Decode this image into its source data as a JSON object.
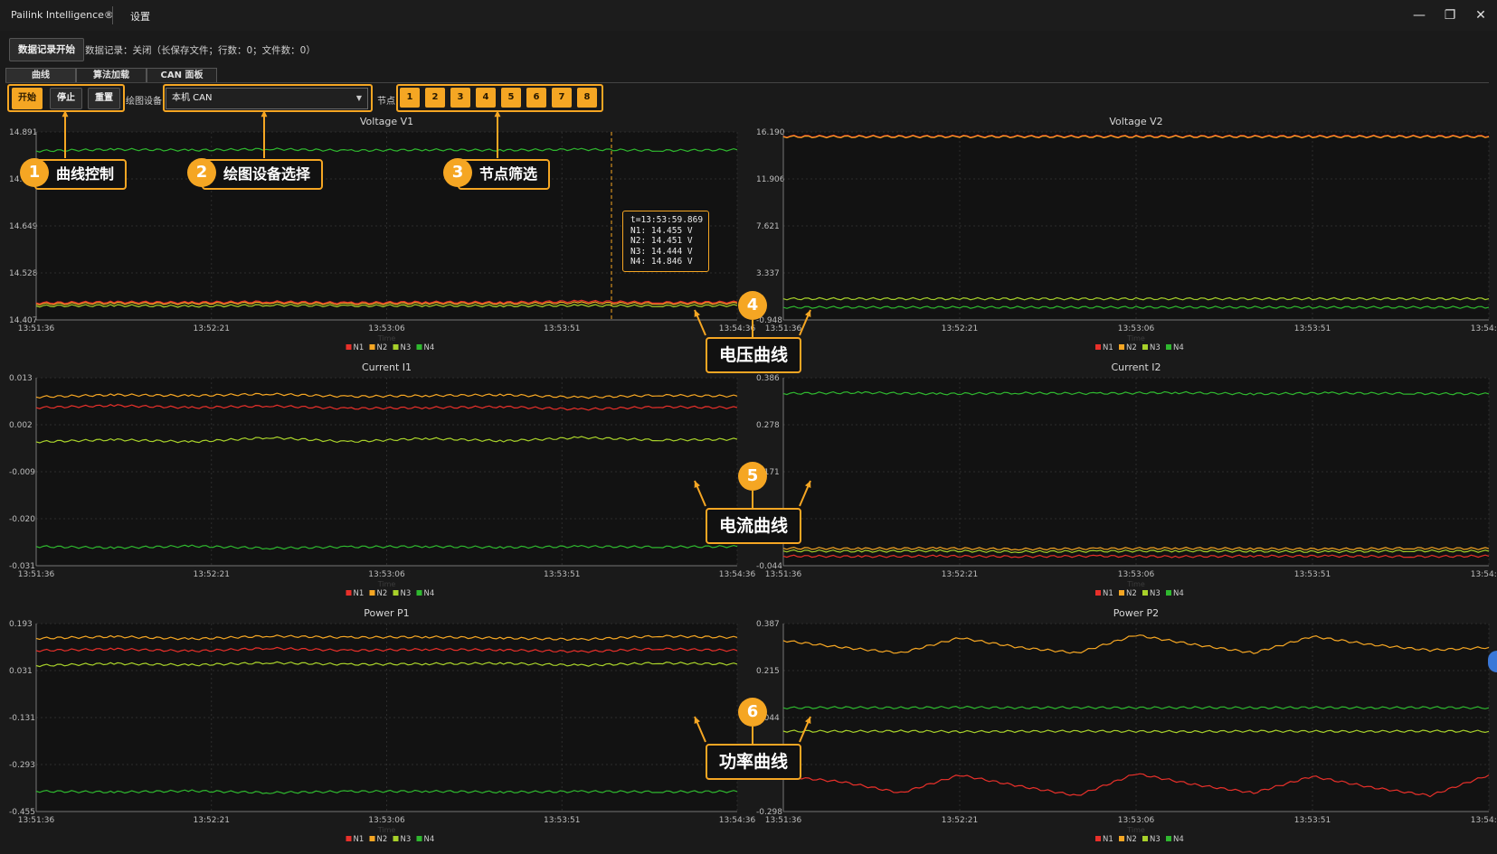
{
  "titlebar": {
    "app_title": "Pailink Intelligence®",
    "settings_label": "设置",
    "minimize_glyph": "—",
    "restore_glyph": "❐",
    "close_glyph": "✕"
  },
  "record": {
    "start_label": "数据记录开始",
    "status": "数据记录：关闭（长保存文件；行数：0；文件数：0）"
  },
  "tabs": [
    {
      "label": "曲线",
      "active": true
    },
    {
      "label": "算法加载",
      "active": false
    },
    {
      "label": "CAN 面板",
      "active": false
    }
  ],
  "controls": {
    "start": "开始",
    "stop": "停止",
    "reset": "重置",
    "device_label": "绘图设备",
    "device_value": "本机 CAN",
    "node_label": "节点",
    "nodes": [
      "1",
      "2",
      "3",
      "4",
      "5",
      "6",
      "7",
      "8"
    ]
  },
  "annotations": {
    "n1": "1",
    "l1": "曲线控制",
    "n2": "2",
    "l2": "绘图设备选择",
    "n3": "3",
    "l3": "节点筛选",
    "n4": "4",
    "l4": "电压曲线",
    "n5": "5",
    "l5": "电流曲线",
    "n6": "6",
    "l6": "功率曲线"
  },
  "tooltip": {
    "t": "t=13:53:59.869",
    "n1": "N1: 14.455 V",
    "n2": "N2: 14.451 V",
    "n3": "N3: 14.444 V",
    "n4": "N4: 14.846 V"
  },
  "colors": {
    "accent": "#f5a623",
    "N1": "#e8302a",
    "N2": "#f5a623",
    "N3": "#a8d12a",
    "N4": "#2fb82f",
    "plot_bg": "#121212",
    "grid": "#2c2c2c"
  },
  "chart_data": [
    {
      "type": "line",
      "title": "Voltage V1",
      "xlabel": "Time",
      "x_ticks": [
        "13:51:36",
        "13:52:21",
        "13:53:06",
        "13:53:51",
        "13:54:36"
      ],
      "y_ticks": [
        "14.891",
        "14.770",
        "14.649",
        "14.528",
        "14.407"
      ],
      "ylim": [
        14.407,
        14.891
      ],
      "legend": [
        "N1",
        "N2",
        "N3",
        "N4"
      ],
      "series": [
        {
          "name": "N1",
          "values": [
            14.451,
            14.453,
            14.452,
            14.454,
            14.451,
            14.453,
            14.452,
            14.455,
            14.452,
            14.453
          ]
        },
        {
          "name": "N2",
          "values": [
            14.448,
            14.45,
            14.449,
            14.451,
            14.448,
            14.45,
            14.449,
            14.451,
            14.449,
            14.45
          ]
        },
        {
          "name": "N3",
          "values": [
            14.443,
            14.444,
            14.442,
            14.445,
            14.443,
            14.444,
            14.443,
            14.444,
            14.443,
            14.444
          ]
        },
        {
          "name": "N4",
          "values": [
            14.842,
            14.846,
            14.844,
            14.847,
            14.843,
            14.845,
            14.844,
            14.846,
            14.843,
            14.845
          ]
        }
      ]
    },
    {
      "type": "line",
      "title": "Voltage V2",
      "xlabel": "Time",
      "x_ticks": [
        "13:51:36",
        "13:52:21",
        "13:53:06",
        "13:53:51",
        "13:54:36"
      ],
      "y_ticks": [
        "16.190",
        "11.906",
        "7.621",
        "3.337",
        "-0.948"
      ],
      "ylim": [
        -0.948,
        16.19
      ],
      "legend": [
        "N1",
        "N2",
        "N3",
        "N4"
      ],
      "series": [
        {
          "name": "N1",
          "values": [
            15.8,
            15.8,
            15.8,
            15.8,
            15.8
          ]
        },
        {
          "name": "N2",
          "values": [
            15.75,
            15.75,
            15.75,
            15.75,
            15.75
          ]
        },
        {
          "name": "N3",
          "values": [
            0.98,
            0.98,
            0.98,
            0.98,
            0.98
          ]
        },
        {
          "name": "N4",
          "values": [
            0.2,
            0.2,
            0.2,
            0.2,
            0.2
          ]
        }
      ]
    },
    {
      "type": "line",
      "title": "Current I1",
      "xlabel": "Time",
      "x_ticks": [
        "13:51:36",
        "13:52:21",
        "13:53:06",
        "13:53:51",
        "13:54:36"
      ],
      "y_ticks": [
        "0.013",
        "0.002",
        "-0.009",
        "-0.020",
        "-0.031"
      ],
      "ylim": [
        -0.031,
        0.013
      ],
      "legend": [
        "N1",
        "N2",
        "N3",
        "N4"
      ],
      "series": [
        {
          "name": "N1",
          "values": [
            0.006,
            0.0065,
            0.006,
            0.0064,
            0.0058,
            0.006,
            0.0062,
            0.0056,
            0.0062,
            0.006
          ]
        },
        {
          "name": "N2",
          "values": [
            0.0085,
            0.009,
            0.0088,
            0.0092,
            0.0086,
            0.0088,
            0.009,
            0.0084,
            0.0089,
            0.0087
          ]
        },
        {
          "name": "N3",
          "values": [
            -0.002,
            -0.0015,
            -0.002,
            -0.001,
            -0.002,
            -0.0012,
            -0.0018,
            -0.001,
            -0.0016,
            -0.0014
          ]
        },
        {
          "name": "N4",
          "values": [
            -0.0265,
            -0.0268,
            -0.0264,
            -0.0269,
            -0.0266,
            -0.0265,
            -0.0267,
            -0.0265,
            -0.0266,
            -0.0265
          ]
        }
      ]
    },
    {
      "type": "line",
      "title": "Current I2",
      "xlabel": "Time",
      "x_ticks": [
        "13:51:36",
        "13:52:21",
        "13:53:06",
        "13:53:51",
        "13:54:36"
      ],
      "y_ticks": [
        "0.386",
        "0.278",
        "0.171",
        "0.063",
        "-0.044"
      ],
      "ylim": [
        -0.044,
        0.386
      ],
      "legend": [
        "N1",
        "N2",
        "N3",
        "N4"
      ],
      "series": [
        {
          "name": "N1",
          "values": [
            -0.022,
            -0.023,
            -0.022,
            -0.023,
            -0.022,
            -0.023,
            -0.022,
            -0.022,
            -0.023,
            -0.022
          ]
        },
        {
          "name": "N2",
          "values": [
            -0.004,
            -0.005,
            -0.004,
            -0.006,
            -0.005,
            -0.004,
            -0.005,
            -0.006,
            -0.004,
            -0.005
          ]
        },
        {
          "name": "N3",
          "values": [
            -0.01,
            -0.011,
            -0.01,
            -0.012,
            -0.011,
            -0.01,
            -0.011,
            -0.012,
            -0.01,
            -0.011
          ]
        },
        {
          "name": "N4",
          "values": [
            0.35,
            0.352,
            0.349,
            0.351,
            0.35,
            0.352,
            0.349,
            0.351,
            0.35,
            0.349
          ]
        }
      ]
    },
    {
      "type": "line",
      "title": "Power P1",
      "xlabel": "Time",
      "x_ticks": [
        "13:51:36",
        "13:52:21",
        "13:53:06",
        "13:53:51",
        "13:54:36"
      ],
      "y_ticks": [
        "0.193",
        "0.031",
        "-0.131",
        "-0.293",
        "-0.455"
      ],
      "ylim": [
        -0.455,
        0.193
      ],
      "legend": [
        "N1",
        "N2",
        "N3",
        "N4"
      ],
      "series": [
        {
          "name": "N1",
          "values": [
            0.1,
            0.105,
            0.098,
            0.108,
            0.1,
            0.104,
            0.102,
            0.096,
            0.106,
            0.1
          ]
        },
        {
          "name": "N2",
          "values": [
            0.142,
            0.148,
            0.14,
            0.15,
            0.145,
            0.147,
            0.143,
            0.138,
            0.15,
            0.145
          ]
        },
        {
          "name": "N3",
          "values": [
            0.048,
            0.055,
            0.05,
            0.058,
            0.052,
            0.054,
            0.056,
            0.049,
            0.057,
            0.053
          ]
        },
        {
          "name": "N4",
          "values": [
            -0.385,
            -0.388,
            -0.384,
            -0.39,
            -0.386,
            -0.385,
            -0.388,
            -0.386,
            -0.387,
            -0.386
          ]
        }
      ]
    },
    {
      "type": "line",
      "title": "Power P2",
      "xlabel": "Time",
      "x_ticks": [
        "13:51:36",
        "13:52:21",
        "13:53:06",
        "13:53:51",
        "13:54:36"
      ],
      "y_ticks": [
        "0.387",
        "0.215",
        "0.044",
        "-0.127",
        "-0.298"
      ],
      "ylim": [
        -0.298,
        0.387
      ],
      "legend": [
        "N1",
        "N2",
        "N3",
        "N4"
      ],
      "series": [
        {
          "name": "N1",
          "values": [
            -0.17,
            -0.19,
            -0.23,
            -0.165,
            -0.205,
            -0.24,
            -0.16,
            -0.2,
            -0.23,
            -0.17,
            -0.21,
            -0.24,
            -0.165
          ]
        },
        {
          "name": "N2",
          "values": [
            0.325,
            0.3,
            0.28,
            0.335,
            0.3,
            0.28,
            0.345,
            0.31,
            0.28,
            0.34,
            0.31,
            0.29,
            0.3
          ]
        },
        {
          "name": "N3",
          "values": [
            -0.005,
            -0.006,
            -0.005,
            -0.007,
            -0.006,
            -0.005,
            -0.006,
            -0.007,
            -0.005,
            -0.006,
            -0.006,
            -0.005,
            -0.006
          ]
        },
        {
          "name": "N4",
          "values": [
            0.08,
            0.081,
            0.08,
            0.082,
            0.08,
            0.081,
            0.08,
            0.081,
            0.08,
            0.081,
            0.08,
            0.081,
            0.08
          ]
        }
      ]
    }
  ]
}
